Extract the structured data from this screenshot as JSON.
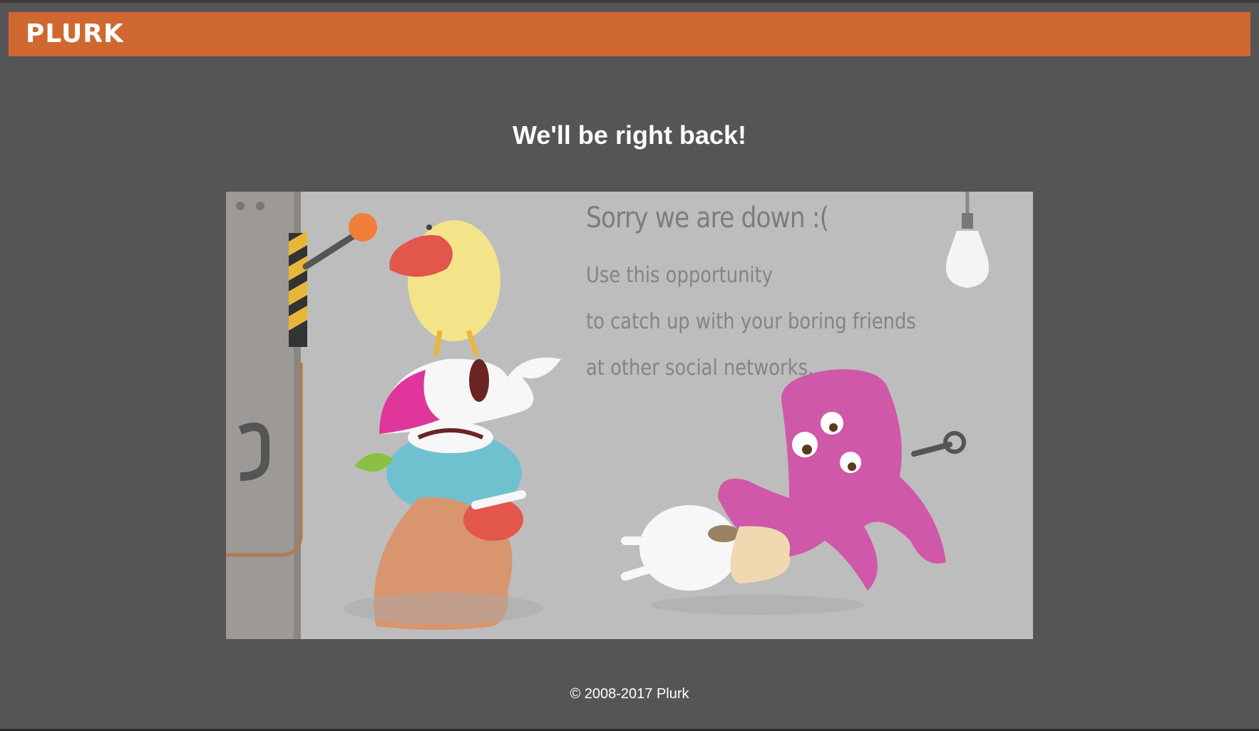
{
  "header": {
    "logo_text": "PLURK",
    "brand_color": "#cf6830"
  },
  "main": {
    "headline": "We'll be right back!",
    "illustration": {
      "title": "Sorry we are down :(",
      "lines": [
        "Use this opportunity",
        "to catch up with your boring friends",
        "at other social networks."
      ]
    }
  },
  "footer": {
    "copyright": "© 2008-2017 Plurk"
  },
  "colors": {
    "page_bg": "#555555",
    "illustration_bg": "#bdbdbd"
  }
}
